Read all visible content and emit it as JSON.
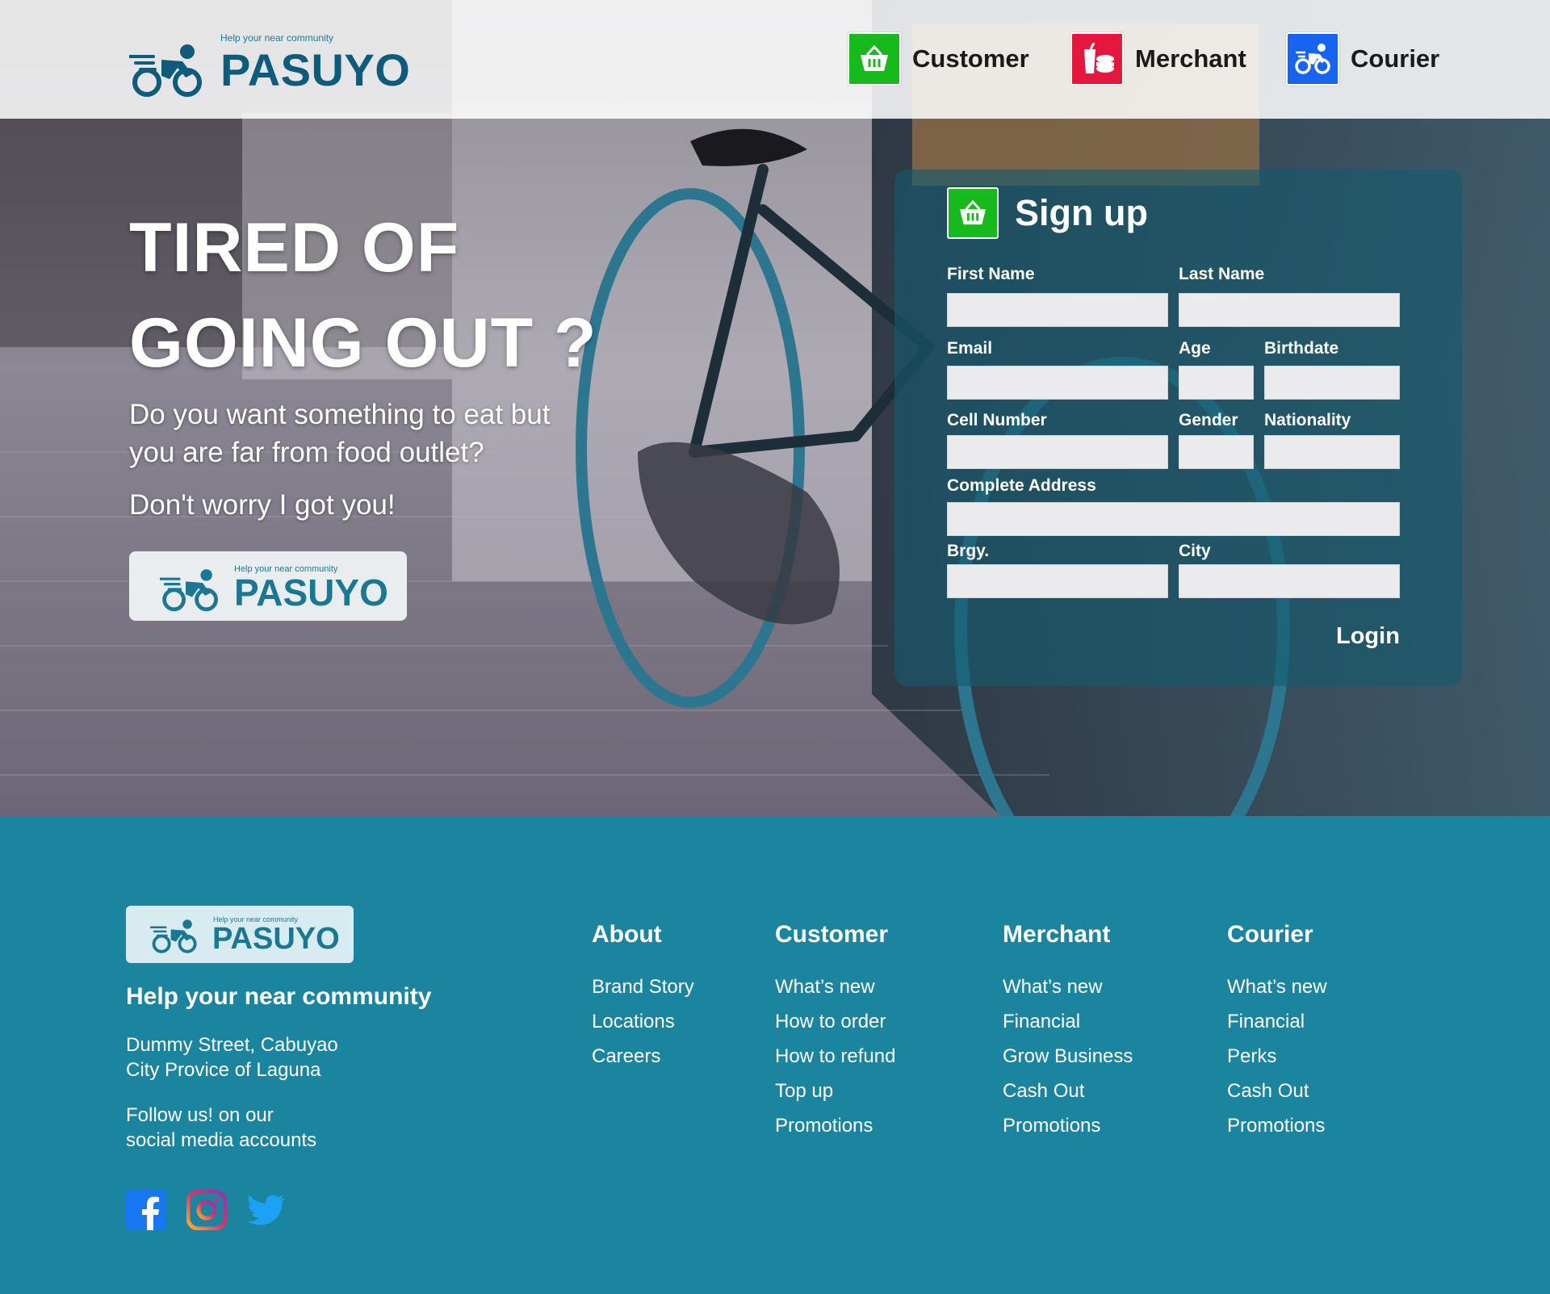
{
  "colors": {
    "brand_dark": "#0e5b7b",
    "brand": "#1b849e",
    "customer_green": "#18b91c",
    "merchant_red": "#e5173f",
    "courier_blue": "#1764f1"
  },
  "header": {
    "logo": {
      "tagline": "Help your near community",
      "name": "PASUYO"
    },
    "nav": [
      {
        "label": "Customer",
        "icon": "basket-icon"
      },
      {
        "label": "Merchant",
        "icon": "food-icon"
      },
      {
        "label": "Courier",
        "icon": "bike-icon"
      }
    ]
  },
  "hero": {
    "headline_line1": "TIRED OF",
    "headline_line2": "GOING OUT ?",
    "subtext": "Do you want something to eat but you are far from food outlet?",
    "subtext2": "Don't worry I got you!",
    "logo": {
      "tagline": "Help your near community",
      "name": "PASUYO"
    }
  },
  "signup": {
    "title": "Sign up",
    "fields": {
      "first_name": "First Name",
      "last_name": "Last Name",
      "email": "Email",
      "age": "Age",
      "birthdate": "Birthdate",
      "cell_number": "Cell Number",
      "gender": "Gender",
      "nationality": "Nationality",
      "address": "Complete Address",
      "brgy": "Brgy.",
      "city": "City"
    },
    "login_label": "Login"
  },
  "footer": {
    "logo": {
      "tagline": "Help your near community",
      "name": "PASUYO"
    },
    "tagline": "Help your near community",
    "address": "Dummy Street, Cabuyao\nCity Provice of Laguna",
    "follow": "Follow us! on our\nsocial media accounts",
    "social": [
      "facebook-icon",
      "instagram-icon",
      "twitter-icon"
    ],
    "columns": {
      "about": {
        "title": "About",
        "links": [
          "Brand Story",
          "Locations",
          "Careers"
        ]
      },
      "customer": {
        "title": "Customer",
        "links": [
          "What’s new",
          "How to order",
          "How to refund",
          "Top up",
          "Promotions"
        ]
      },
      "merchant": {
        "title": "Merchant",
        "links": [
          "What’s new",
          "Financial",
          "Grow Business",
          "Cash Out",
          "Promotions"
        ]
      },
      "courier": {
        "title": "Courier",
        "links": [
          "What’s new",
          "Financial",
          "Perks",
          "Cash Out",
          "Promotions"
        ]
      }
    }
  }
}
